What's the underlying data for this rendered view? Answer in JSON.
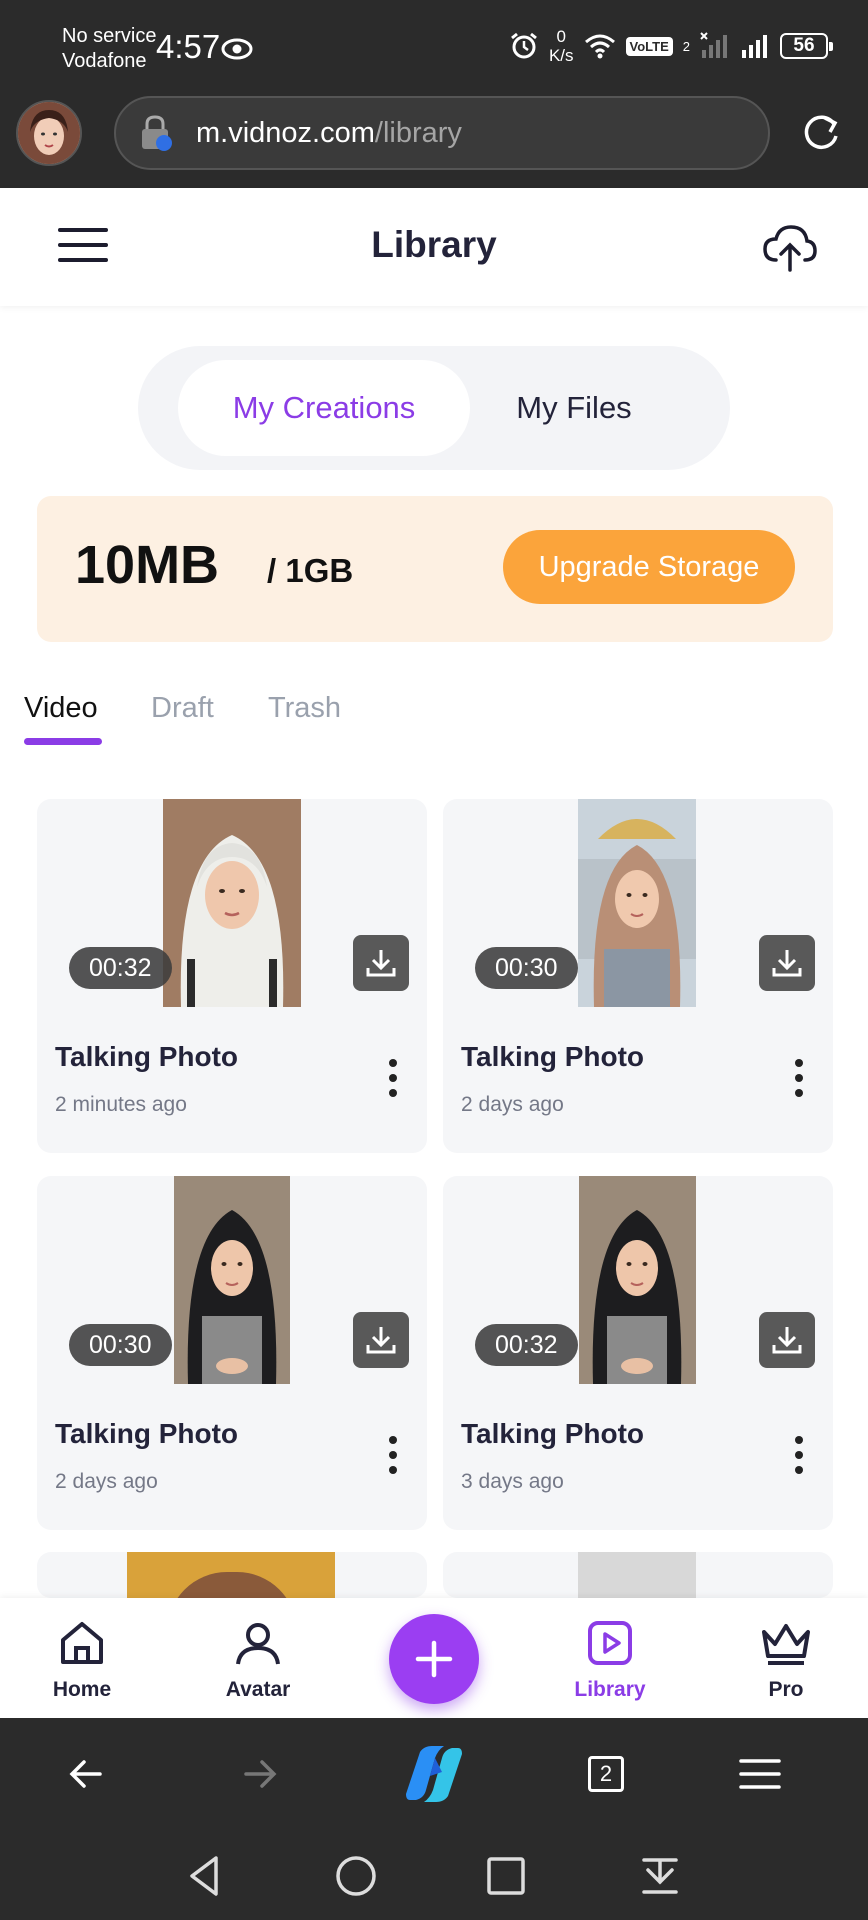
{
  "status_bar": {
    "carrier_line1": "No service",
    "carrier_line2": "Vodafone",
    "time": "4:57",
    "speed_value": "0",
    "speed_unit": "K/s",
    "volte": "VoLTE",
    "sim_index": "2",
    "battery": "56"
  },
  "browser": {
    "url_host": "m.vidnoz.com",
    "url_path": "/library"
  },
  "header": {
    "title": "Library"
  },
  "segmented": {
    "creations": "My Creations",
    "files": "My Files"
  },
  "storage": {
    "used": "10MB",
    "total": "/ 1GB",
    "upgrade_label": "Upgrade Storage"
  },
  "tabs": {
    "video": "Video",
    "draft": "Draft",
    "trash": "Trash"
  },
  "videos": [
    {
      "duration": "00:32",
      "title": "Talking Photo",
      "time": "2 minutes ago"
    },
    {
      "duration": "00:30",
      "title": "Talking Photo",
      "time": "2 days ago"
    },
    {
      "duration": "00:30",
      "title": "Talking Photo",
      "time": "2 days ago"
    },
    {
      "duration": "00:32",
      "title": "Talking Photo",
      "time": "3 days ago"
    }
  ],
  "bottom_nav": {
    "home": "Home",
    "avatar": "Avatar",
    "library": "Library",
    "pro": "Pro"
  },
  "colors": {
    "accent": "#8b3ce6",
    "upgrade": "#fba43b",
    "storage_bg": "#fdf0e2",
    "dark_bar": "#2b2b2b"
  },
  "tab_count": "2"
}
